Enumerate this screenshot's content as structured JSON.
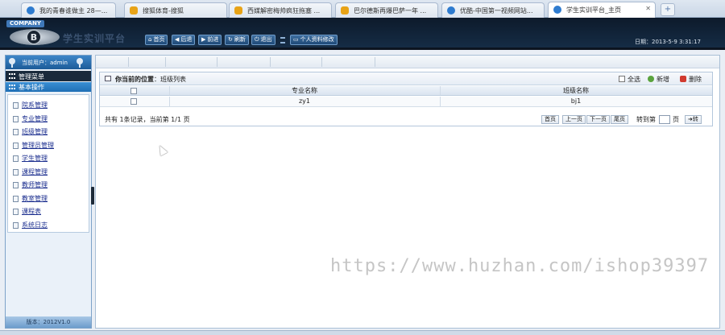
{
  "browser": {
    "tabs": [
      {
        "label": "我的青春谁做主 28—...",
        "icon": "globe-icon"
      },
      {
        "label": "搜狐体育-搜狐",
        "icon": "paw-icon"
      },
      {
        "label": "西媒解密梅帅疯狂拖塞 ...",
        "icon": "paw-icon"
      },
      {
        "label": "巴尔德斯再爆巴萨一年 ...",
        "icon": "paw-icon"
      },
      {
        "label": "优酷-中国第一视频网站...",
        "icon": "globe-icon"
      },
      {
        "label": "学生实训平台_主页",
        "icon": "globe-icon",
        "active": true
      }
    ],
    "new_tab": "+"
  },
  "header": {
    "company": "COMPANY",
    "logo_letter": "B",
    "brand": "学生实训平台",
    "nav": [
      {
        "label": "首页",
        "icon": "home-icon",
        "glyph": "⌂"
      },
      {
        "label": "后退",
        "icon": "back-icon",
        "glyph": "◀"
      },
      {
        "label": "前进",
        "icon": "forward-icon",
        "glyph": "▶"
      },
      {
        "label": "刷新",
        "icon": "refresh-icon",
        "glyph": "↻"
      },
      {
        "label": "退出",
        "icon": "power-icon",
        "glyph": "⏻"
      }
    ],
    "password_button": "个人资料修改",
    "clock": "日期：2013-5-9 3:31:17"
  },
  "sidebar": {
    "user": "当前用户：admin",
    "menu_title": "管理菜单",
    "section_title": "基本操作",
    "items": [
      "院系管理",
      "专业管理",
      "班级管理",
      "管理员管理",
      "学生管理",
      "课程管理",
      "教师管理",
      "教室管理",
      "课程表",
      "系统日志"
    ],
    "version": "版本：2012V1.0"
  },
  "content": {
    "location_label": "你当前的位置",
    "location_value": "班级列表",
    "actions": {
      "select_all": "全选",
      "add": "新增",
      "delete": "删除"
    },
    "table": {
      "headers": [
        "专业名称",
        "班级名称"
      ],
      "rows": [
        [
          "zy1",
          "bj1"
        ]
      ]
    },
    "pager": {
      "info": "共有 1条记录，当前第 1/1 页",
      "first": "首页",
      "prev": "上一页",
      "next": "下一页",
      "last": "尾页",
      "goto_label": "转到第",
      "page_unit": "页",
      "go": "➜转"
    }
  },
  "watermark": "https://www.huzhan.com/ishop39397"
}
